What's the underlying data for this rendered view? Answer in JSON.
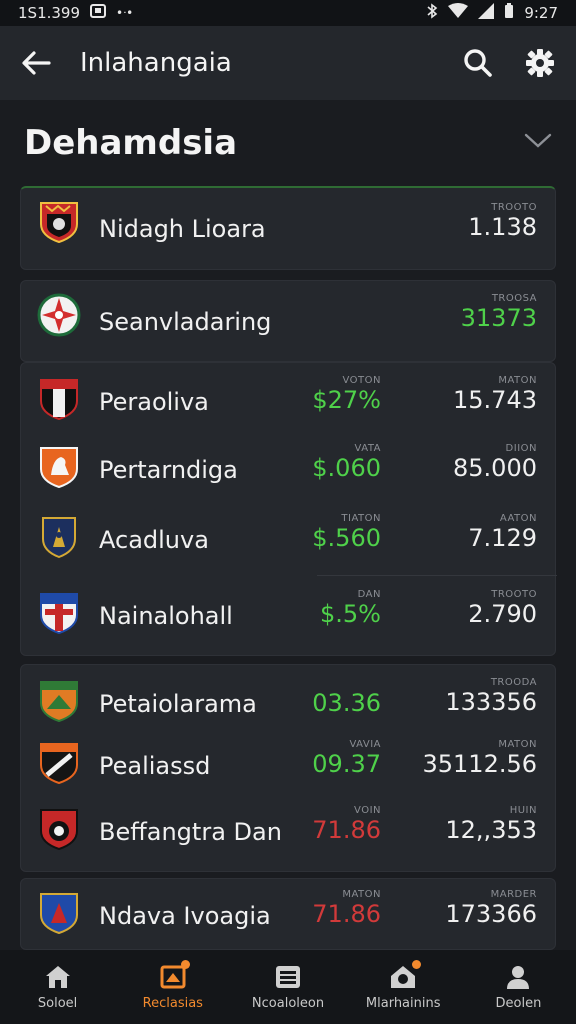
{
  "status": {
    "time_left": "1S1.399",
    "time_right": "9:27"
  },
  "appbar": {
    "title": "Inlahangaia"
  },
  "section": {
    "title": "Dehamdsia"
  },
  "colors": {
    "accent": "#f28a2e",
    "green": "#4fd14a",
    "red": "#d23a3a"
  },
  "cards": [
    {
      "rows": [
        {
          "name": "Nidagh Lioara",
          "badge": "red-black-shield-icon",
          "c2cap": "TROOTO",
          "c2": "1.138",
          "c2color": "green"
        }
      ]
    },
    {
      "rows": [
        {
          "name": "Seanvladaring",
          "badge": "red-star-circle-icon",
          "c2cap": "TROOSA",
          "c2": "31373",
          "c2color": "green"
        }
      ]
    },
    {
      "rows": [
        {
          "name": "Peraoliva",
          "badge": "black-white-shield-icon",
          "c1cap": "VOTON",
          "c1": "$27%",
          "c1color": "green",
          "c2cap": "MATON",
          "c2": "15.743",
          "c2color": "green"
        },
        {
          "name": "Pertarndiga",
          "badge": "orange-shield-icon",
          "c1cap": "VATA",
          "c1": "$.060",
          "c1color": "green",
          "c2cap": "DIION",
          "c2": "85.000",
          "c2color": "green"
        },
        {
          "name": "Acadluva",
          "badge": "navy-gold-shield-icon",
          "c1cap": "TIATON",
          "c1": "$.560",
          "c1color": "green",
          "c2cap": "AATON",
          "c2": "7.129",
          "c2color": "green"
        },
        {
          "name": "Nainalohall",
          "badge": "blue-red-shield-icon",
          "c1cap": "DAN",
          "c1": "$.5%",
          "c1color": "green",
          "c2cap": "TROOTO",
          "c2": "2.790",
          "c2color": "green"
        }
      ]
    },
    {
      "rows": [
        {
          "name": "Petaiolarama",
          "badge": "green-orange-shield-icon",
          "c1": "03.36",
          "c1color": "green",
          "c2cap": "TROODA",
          "c2": "133356",
          "c2color": "green"
        },
        {
          "name": "Pealiassd",
          "badge": "black-orange-shield-icon",
          "c1cap": "VAVIA",
          "c1": "09.37",
          "c1color": "green",
          "c2cap": "MATON",
          "c2": "35112.56",
          "c2color": "green"
        },
        {
          "name": "Beffangtra Dan",
          "badge": "red-crest-shield-icon",
          "c1cap": "VOIN",
          "c1": "71.86",
          "c1color": "red",
          "c2cap": "HUIN",
          "c2": "12,,353",
          "c2color": "green"
        }
      ]
    },
    {
      "rows": [
        {
          "name": "Ndava Ivoagia",
          "badge": "blue-red-crest-icon",
          "c1cap": "MATON",
          "c1": "71.86",
          "c1color": "red",
          "c2cap": "MARDER",
          "c2": "173366",
          "c2color": "green"
        }
      ]
    }
  ],
  "nav": [
    {
      "label": "Soloel",
      "icon": "home-icon"
    },
    {
      "label": "Reclasias",
      "icon": "news-icon"
    },
    {
      "label": "Ncoaloleon",
      "icon": "list-icon"
    },
    {
      "label": "Mlarhainins",
      "icon": "stadium-icon"
    },
    {
      "label": "Deolen",
      "icon": "person-icon"
    }
  ]
}
